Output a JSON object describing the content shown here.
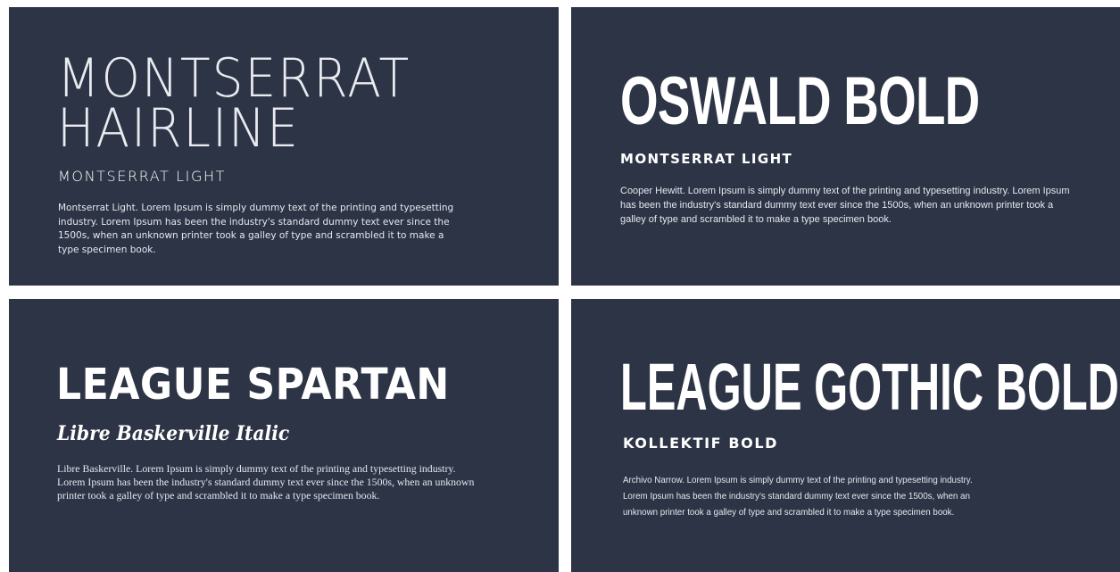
{
  "cards": [
    {
      "heading": "MONTSERRAT HAIRLINE",
      "subheading": "MONTSERRAT LIGHT",
      "body": "Montserrat Light. Lorem Ipsum is simply dummy text of the printing and typesetting industry. Lorem Ipsum has been the industry's standard dummy text ever since the 1500s, when an unknown printer took a galley of type and scrambled it to make a type specimen book."
    },
    {
      "heading": "OSWALD BOLD",
      "subheading": "MONTSERRAT LIGHT",
      "body": "Cooper Hewitt. Lorem Ipsum is simply dummy text of the printing and typesetting industry. Lorem Ipsum has been the industry's standard dummy text ever since the 1500s, when an unknown printer took a galley of type and scrambled it to make a type specimen book."
    },
    {
      "heading": "LEAGUE SPARTAN",
      "subheading": "Libre Baskerville Italic",
      "body": "Libre Baskerville. Lorem Ipsum is simply dummy text of the printing and typesetting industry. Lorem Ipsum has been the industry's standard dummy text ever since the 1500s, when an unknown printer took a galley of type and scrambled it to make a type specimen book."
    },
    {
      "heading": "LEAGUE GOTHIC BOLD",
      "subheading": "KOLLEKTIF BOLD",
      "body": "Archivo Narrow. Lorem Ipsum is simply dummy text of the printing and typesetting industry. Lorem Ipsum has been the industry's standard dummy text ever since the 1500s, when an unknown printer took a galley of type and scrambled it to make a type specimen book."
    }
  ],
  "colors": {
    "card_background": "#2d3446",
    "page_background": "#ffffff",
    "text": "#ffffff"
  }
}
